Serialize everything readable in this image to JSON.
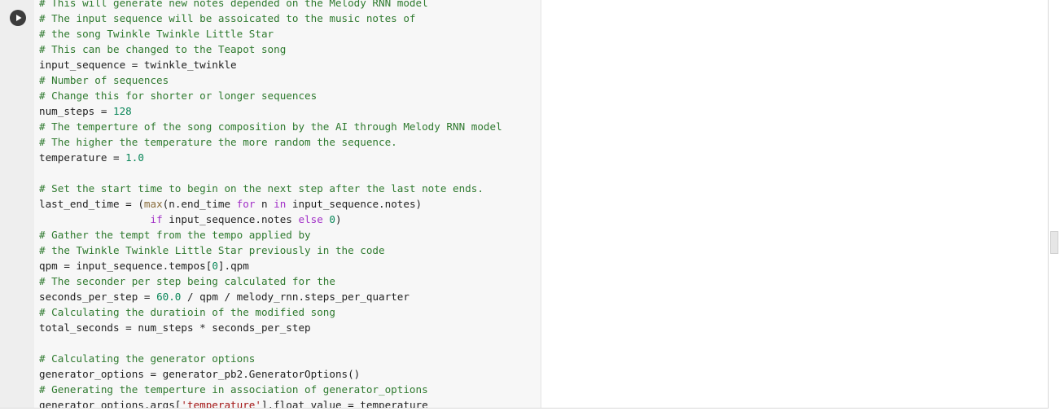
{
  "run_button": {
    "icon": "play-icon"
  },
  "code_lines": [
    [
      {
        "t": "# This will generate new notes depended on the Melody RNN model",
        "c": "comment"
      }
    ],
    [
      {
        "t": "# The input sequence will be assoicated to the music notes of",
        "c": "comment"
      }
    ],
    [
      {
        "t": "# the song Twinkle Twinkle Little Star",
        "c": "comment"
      }
    ],
    [
      {
        "t": "# This can be changed to the Teapot song",
        "c": "comment"
      }
    ],
    [
      {
        "t": "input_sequence = twinkle_twinkle",
        "c": "plain"
      }
    ],
    [
      {
        "t": "# Number of sequences",
        "c": "comment"
      }
    ],
    [
      {
        "t": "# Change this for shorter or longer sequences",
        "c": "comment"
      }
    ],
    [
      {
        "t": "num_steps = ",
        "c": "plain"
      },
      {
        "t": "128",
        "c": "number"
      }
    ],
    [
      {
        "t": "# The temperture of the song composition by the AI through Melody RNN model",
        "c": "comment"
      }
    ],
    [
      {
        "t": "# The higher the temperature the more random the sequence.",
        "c": "comment"
      }
    ],
    [
      {
        "t": "temperature = ",
        "c": "plain"
      },
      {
        "t": "1.0",
        "c": "number"
      }
    ],
    [],
    [
      {
        "t": "# Set the start time to begin on the next step after the last note ends.",
        "c": "comment"
      }
    ],
    [
      {
        "t": "last_end_time = (",
        "c": "plain"
      },
      {
        "t": "max",
        "c": "builtin"
      },
      {
        "t": "(n.end_time ",
        "c": "plain"
      },
      {
        "t": "for",
        "c": "keyword"
      },
      {
        "t": " n ",
        "c": "plain"
      },
      {
        "t": "in",
        "c": "keyword"
      },
      {
        "t": " input_sequence.notes)",
        "c": "plain"
      }
    ],
    [
      {
        "t": "                  ",
        "c": "plain"
      },
      {
        "t": "if",
        "c": "keyword"
      },
      {
        "t": " input_sequence.notes ",
        "c": "plain"
      },
      {
        "t": "else",
        "c": "keyword"
      },
      {
        "t": " ",
        "c": "plain"
      },
      {
        "t": "0",
        "c": "number"
      },
      {
        "t": ")",
        "c": "plain"
      }
    ],
    [
      {
        "t": "# Gather the tempt from the tempo applied by",
        "c": "comment"
      }
    ],
    [
      {
        "t": "# the Twinkle Twinkle Little Star previously in the code",
        "c": "comment"
      }
    ],
    [
      {
        "t": "qpm = input_sequence.tempos[",
        "c": "plain"
      },
      {
        "t": "0",
        "c": "number"
      },
      {
        "t": "].qpm",
        "c": "plain"
      }
    ],
    [
      {
        "t": "# The seconder per step being calculated for the",
        "c": "comment"
      }
    ],
    [
      {
        "t": "seconds_per_step = ",
        "c": "plain"
      },
      {
        "t": "60.0",
        "c": "number"
      },
      {
        "t": " / qpm / melody_rnn.steps_per_quarter",
        "c": "plain"
      }
    ],
    [
      {
        "t": "# Calculating the duratioin of the modified song",
        "c": "comment"
      }
    ],
    [
      {
        "t": "total_seconds = num_steps * seconds_per_step",
        "c": "plain"
      }
    ],
    [],
    [
      {
        "t": "# Calculating the generator options",
        "c": "comment"
      }
    ],
    [
      {
        "t": "generator_options = generator_pb2.GeneratorOptions()",
        "c": "plain"
      }
    ],
    [
      {
        "t": "# Generating the temperture in association of generator_options",
        "c": "comment"
      }
    ],
    [
      {
        "t": "generator_options.args[",
        "c": "plain"
      },
      {
        "t": "'temperature'",
        "c": "string"
      },
      {
        "t": "].float_value = temperature",
        "c": "plain"
      }
    ]
  ]
}
